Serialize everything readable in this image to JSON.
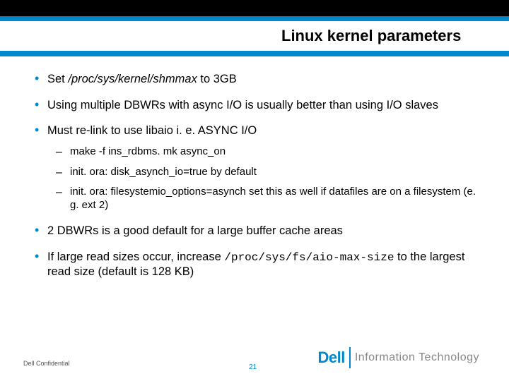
{
  "title": "Linux kernel parameters",
  "bullets": {
    "b1_a": "Set ",
    "b1_i": "/proc/sys/kernel/shmmax",
    "b1_b": " to 3GB",
    "b2": "Using multiple DBWRs with async I/O is usually better than using I/O slaves",
    "b3": "Must re-link to use libaio i. e. ASYNC I/O",
    "s1": "make -f ins_rdbms. mk async_on",
    "s2": "init. ora: disk_asynch_io=true by default",
    "s3": "init. ora: filesystemio_options=asynch set this as well if datafiles are on a filesystem (e. g. ext 2)",
    "b4": "2 DBWRs is a good default for a large buffer cache areas",
    "b5_a": "If large read sizes occur, increase ",
    "b5_m": "/proc/sys/fs/aio-max-size",
    "b5_b": " to the largest read size (default is 128 KB)"
  },
  "footer": {
    "confidential": "Dell Confidential",
    "page": "21",
    "brand_left": "Dell",
    "brand_right": "Information Technology"
  }
}
